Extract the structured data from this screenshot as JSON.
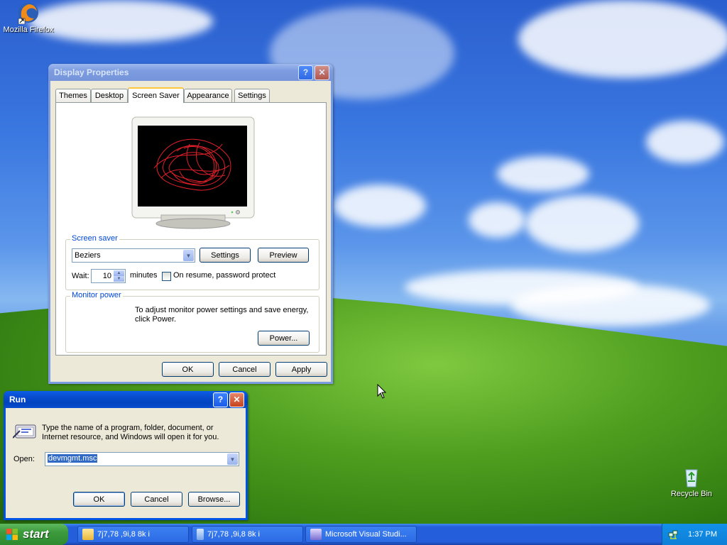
{
  "desktop": {
    "icons": [
      {
        "label": "Mozilla Firefox",
        "icon": "firefox-icon"
      },
      {
        "label": "Recycle Bin",
        "icon": "recycle-bin-icon"
      }
    ]
  },
  "display_properties": {
    "title": "Display Properties",
    "tabs": [
      {
        "label": "Themes",
        "active": false
      },
      {
        "label": "Desktop",
        "active": false
      },
      {
        "label": "Screen Saver",
        "active": true
      },
      {
        "label": "Appearance",
        "active": false
      },
      {
        "label": "Settings",
        "active": false
      }
    ],
    "screen_saver": {
      "group_label": "Screen saver",
      "selected": "Beziers",
      "settings_label": "Settings",
      "preview_label": "Preview",
      "wait_label": "Wait:",
      "wait_value": "10",
      "minutes_label": "minutes",
      "password_label": "On resume, password protect",
      "password_checked": false
    },
    "monitor_power": {
      "group_label": "Monitor power",
      "text": "To adjust monitor power settings and save energy, click Power.",
      "power_label": "Power..."
    },
    "ok_label": "OK",
    "cancel_label": "Cancel",
    "apply_label": "Apply",
    "preview_color": "#e0202a"
  },
  "run_dialog": {
    "title": "Run",
    "description": "Type the name of a program, folder, document, or Internet resource, and Windows will open it for you.",
    "open_label": "Open:",
    "open_value": "devmgmt.msc",
    "ok_label": "OK",
    "cancel_label": "Cancel",
    "browse_label": "Browse..."
  },
  "taskbar": {
    "start_label": "start",
    "buttons": [
      {
        "label": "7j7,78 ,9i,8 8k i",
        "icon": "folder-icon"
      },
      {
        "label": "7j7,78 ,9i,8 8k i",
        "icon": "window-icon"
      },
      {
        "label": "Microsoft Visual Studi...",
        "icon": "visual-studio-icon"
      }
    ],
    "clock": "1:37 PM"
  },
  "colors": {
    "xp_blue": "#0054e3",
    "start_green": "#3c9a3c",
    "dialog_bg": "#ece9d8"
  }
}
